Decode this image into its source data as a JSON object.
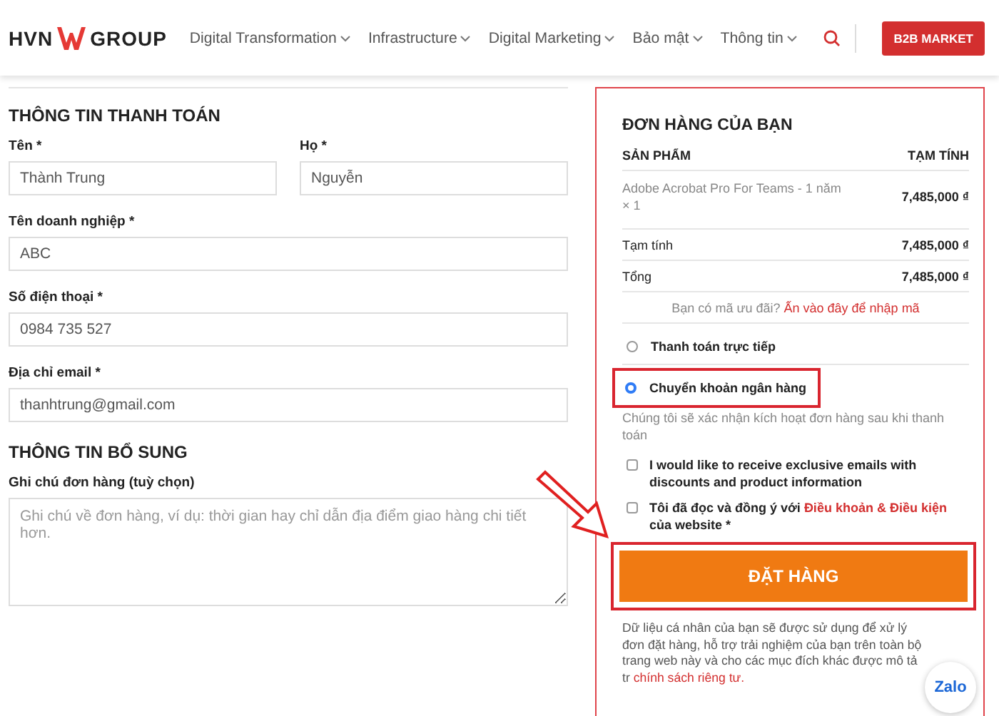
{
  "header": {
    "logo": {
      "left": "HVN",
      "right": "GROUP"
    },
    "nav": [
      {
        "label": "Digital Transformation",
        "has_dropdown": true
      },
      {
        "label": "Infrastructure",
        "has_dropdown": true
      },
      {
        "label": "Digital Marketing",
        "has_dropdown": true
      },
      {
        "label": "Bảo mật",
        "has_dropdown": true
      },
      {
        "label": "Thông tin",
        "has_dropdown": true
      }
    ],
    "b2b_button": "B2B MARKET"
  },
  "billing": {
    "title": "THÔNG TIN THANH TOÁN",
    "rows": [
      [
        {
          "label": "Tên *",
          "value": "Thành Trung"
        },
        {
          "label": "Họ *",
          "value": "Nguyễn"
        }
      ],
      [
        {
          "label": "Tên doanh nghiệp *",
          "value": "ABC"
        }
      ],
      [
        {
          "label": "Số điện thoại *",
          "value": "0984 735 527"
        }
      ],
      [
        {
          "label": "Địa chỉ email *",
          "value": "thanhtrung@gmail.com"
        }
      ]
    ]
  },
  "additional": {
    "title": "THÔNG TIN BỔ SUNG",
    "notes": {
      "label": "Ghi chú đơn hàng (tuỳ chọn)",
      "placeholder": "Ghi chú về đơn hàng, ví dụ: thời gian hay chỉ dẫn địa điểm giao hàng chi tiết hơn."
    }
  },
  "order": {
    "title": "ĐƠN HÀNG CỦA BẠN",
    "columns": [
      "SẢN PHẨM",
      "TẠM TÍNH"
    ],
    "items": [
      {
        "name": "Adobe Acrobat Pro For Teams - 1 năm",
        "quantity": "× 1",
        "total": "7,485,000 ₫"
      }
    ],
    "totals": [
      {
        "label": "Tạm tính",
        "value": "7,485,000 ₫"
      },
      {
        "label": "Tổng",
        "value": "7,485,000 ₫"
      }
    ],
    "coupon": {
      "text": "Bạn có mã ưu đãi?",
      "link": "Ấn vào đây để nhập mã"
    },
    "payment_methods": [
      {
        "label": "Thanh toán trực tiếp",
        "selected": false,
        "highlighted": false
      },
      {
        "label": "Chuyển khoản ngân hàng",
        "selected": true,
        "highlighted": true,
        "description": "Chúng tôi sẽ xác nhận kích hoạt đơn hàng sau khi thanh toán"
      }
    ],
    "consents": [
      {
        "text": "I would like to receive exclusive emails with discounts and product information",
        "checked": false
      },
      {
        "text": "Tôi đã đọc và đồng ý với",
        "link": "Điều khoản & Điều kiện",
        "text_after": "của website *",
        "checked": false
      }
    ],
    "place_order": {
      "label": "ĐẶT HÀNG",
      "highlighted": true
    },
    "privacy": {
      "text": "Dữ liệu cá nhân của bạn sẽ được sử dụng để xử lý đơn đặt hàng, hỗ trợ trải nghiệm của bạn trên toàn bộ trang web này và cho các mục đích khác được mô tả tr",
      "link": "chính sách riêng tư."
    }
  },
  "chat_widget": {
    "label": "Zalo"
  }
}
